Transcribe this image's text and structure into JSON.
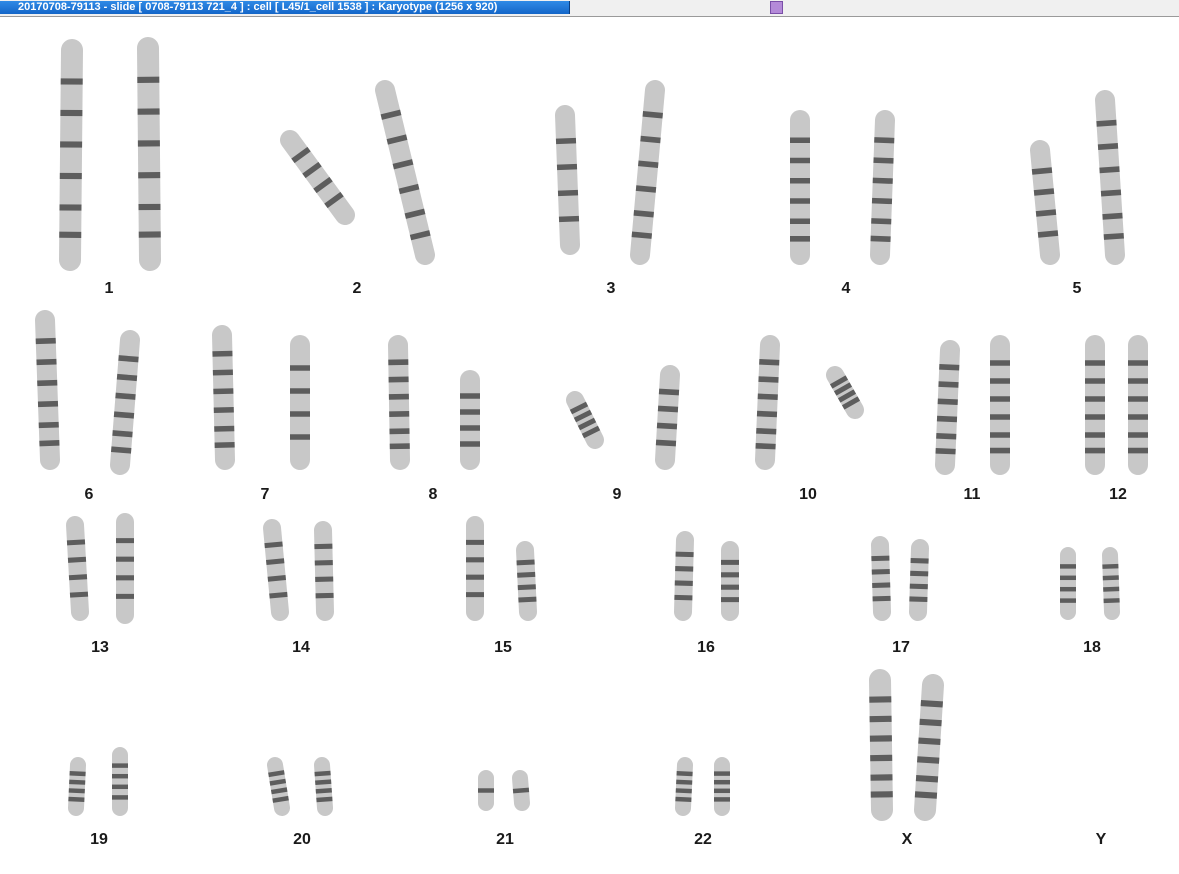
{
  "window": {
    "title": "20170708-79113 - slide [ 0708-79113 721_4 ] : cell [ L45/1_cell 1538 ] : Karyotype  (1256 x 920)"
  },
  "karyotype": {
    "labels": [
      "1",
      "2",
      "3",
      "4",
      "5",
      "6",
      "7",
      "8",
      "9",
      "10",
      "11",
      "12",
      "13",
      "14",
      "15",
      "16",
      "17",
      "18",
      "19",
      "20",
      "21",
      "22",
      "X",
      "Y"
    ]
  },
  "colors": {
    "chromosome_light": "#c8c8c8",
    "chromosome_band": "#3a3a3a",
    "titlebar_accent": "#1466c8",
    "scroll_marker": "#b48ad8"
  }
}
